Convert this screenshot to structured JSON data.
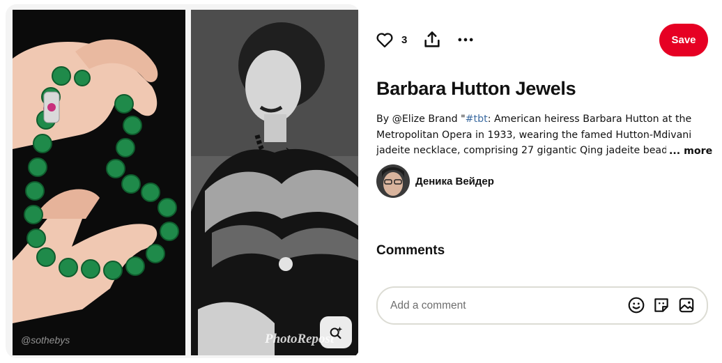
{
  "pin": {
    "like_count": "3",
    "save_label": "Save",
    "title": "Barbara Hutton Jewels",
    "description_prefix": "By @Elize Brand \"",
    "hashtag": "#tbt",
    "description_rest": ": American heiress Barbara Hutton at the Metropolitan Opera in 1933, wearing the famed Hutton-Mdivani jadeite necklace, comprising 27 gigantic Qing jadeite beads",
    "more_label": "... more"
  },
  "image": {
    "watermark_left": "@sothebys",
    "watermark_right": "PhotoRepost"
  },
  "creator": {
    "name": "Деника Вейдер"
  },
  "comments": {
    "heading": "Comments",
    "placeholder": "Add a comment"
  },
  "icons": {
    "like": "heart-icon",
    "share": "share-icon",
    "more": "more-dots-icon",
    "lens": "visual-search-icon",
    "emoji": "emoji-icon",
    "sticker": "sticker-icon",
    "photo": "photo-icon"
  },
  "colors": {
    "save": "#e60023",
    "jade": "#1f8a4a",
    "hashtag": "#3b6aa0"
  }
}
